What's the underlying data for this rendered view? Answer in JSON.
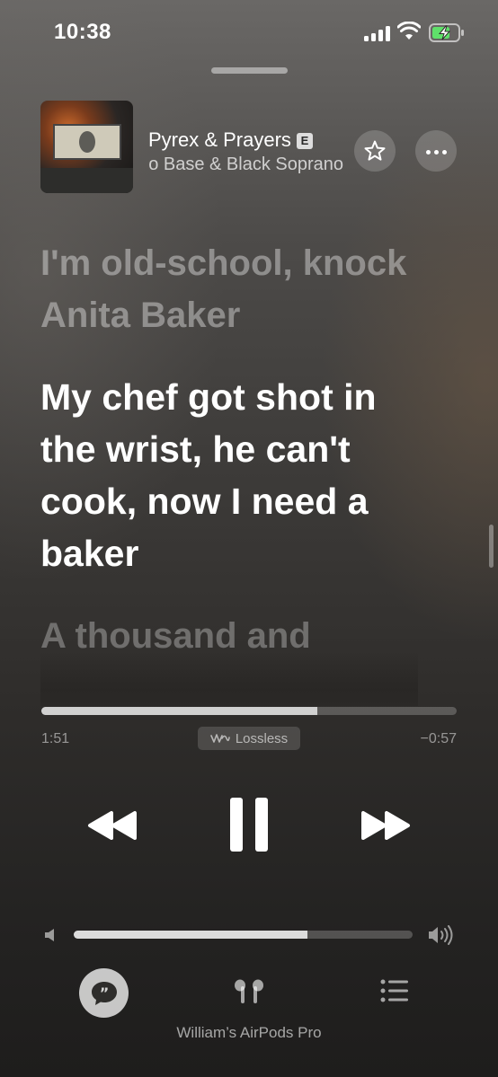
{
  "status_bar": {
    "time": "10:38"
  },
  "now_playing": {
    "title": "Pyrex & Prayers",
    "explicit_badge": "E",
    "artist": "o Base & Black Soprano",
    "artwork_icon": "album-artwork"
  },
  "lyrics": {
    "past": "I'm old-school, knock Anita Baker",
    "current": "My chef got shot in the wrist, he can't cook, now I need a baker",
    "next": "A thousand and"
  },
  "playback": {
    "elapsed": "1:51",
    "remaining": "−0:57",
    "progress": 0.665,
    "quality_label": "Lossless"
  },
  "volume": {
    "level": 0.69
  },
  "output_device": "William’s AirPods Pro",
  "colors": {
    "accent": "#ffffff",
    "background": "#2b2a28"
  }
}
